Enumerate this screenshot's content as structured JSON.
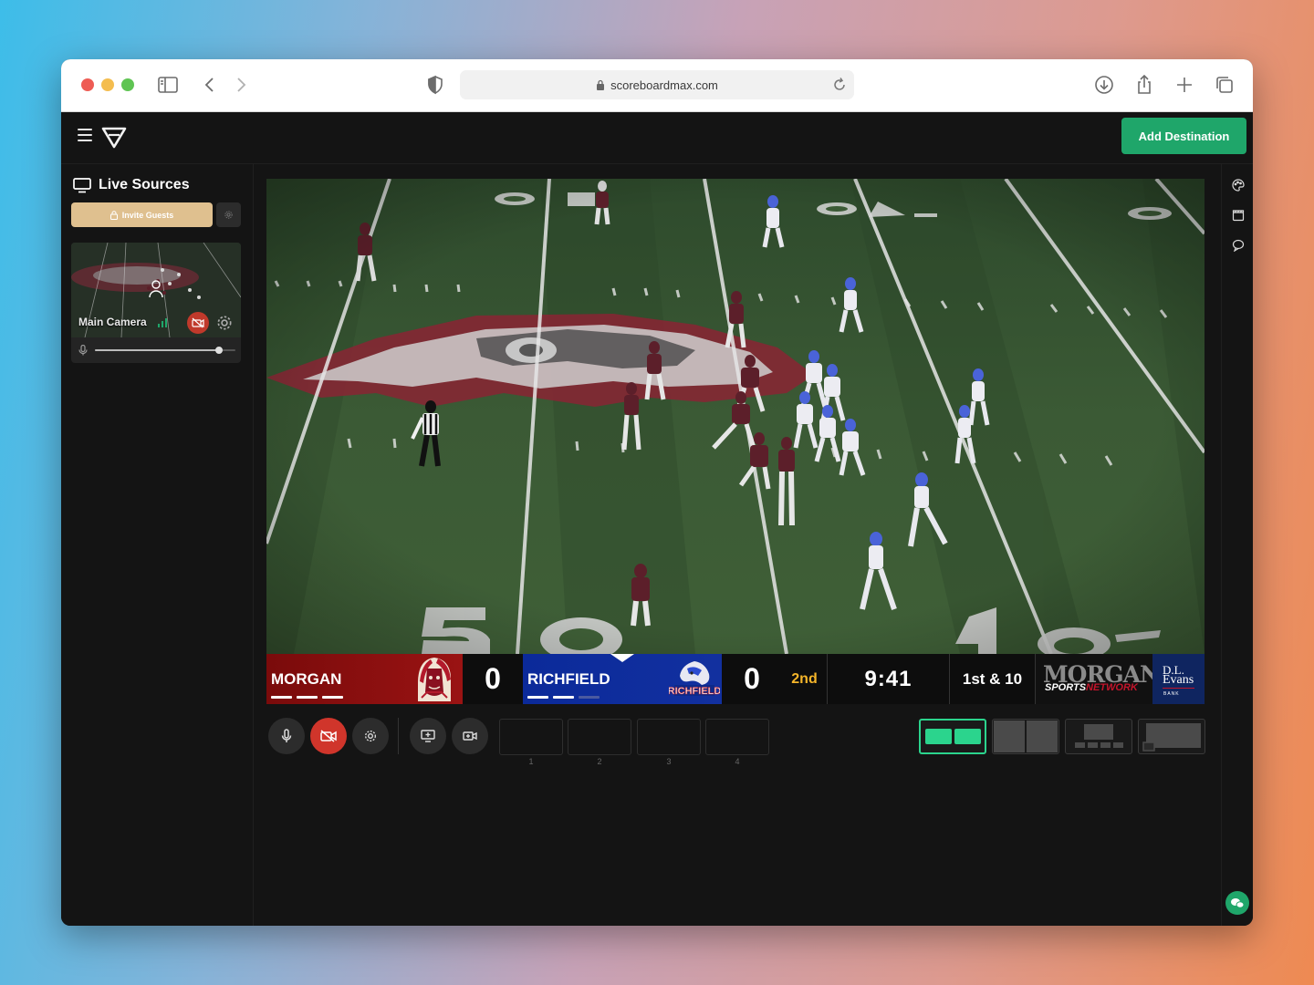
{
  "browser": {
    "url": "scoreboardmax.com",
    "icons": [
      "sidebar-icon",
      "back-icon",
      "forward-icon",
      "shield-icon",
      "lock-icon",
      "reload-icon",
      "download-icon",
      "share-icon",
      "new-tab-icon",
      "tabs-icon"
    ]
  },
  "header": {
    "add_destination_label": "Add Destination",
    "accent_color": "#1fa66a"
  },
  "sidebar": {
    "title": "Live Sources",
    "invite_label": "Invite Guests",
    "source": {
      "label": "Main Camera",
      "camera_off": true,
      "volume_level": 0.88
    }
  },
  "scoreboard": {
    "home": {
      "name": "MORGAN",
      "score": "0",
      "timeouts_remaining": 3,
      "color": "#8a0f0f"
    },
    "away": {
      "name": "RICHFIELD",
      "score": "0",
      "timeouts_remaining": 2,
      "color": "#0b2a9a",
      "possession": true
    },
    "quarter": "2nd",
    "clock": "9:41",
    "down_distance": "1st & 10",
    "network": {
      "line1": "MORGAN",
      "line2a": "SPORTS",
      "line2b": "NETWORK"
    },
    "sponsor": {
      "line1": "D.L.",
      "line2": "Evans",
      "line3": "BANK"
    }
  },
  "controls": {
    "slots": [
      "1",
      "2",
      "3",
      "4"
    ],
    "layouts": [
      "side-by-side-layout",
      "split-layout",
      "grid-layout",
      "picture-in-picture-layout"
    ],
    "active_layout": 0
  }
}
